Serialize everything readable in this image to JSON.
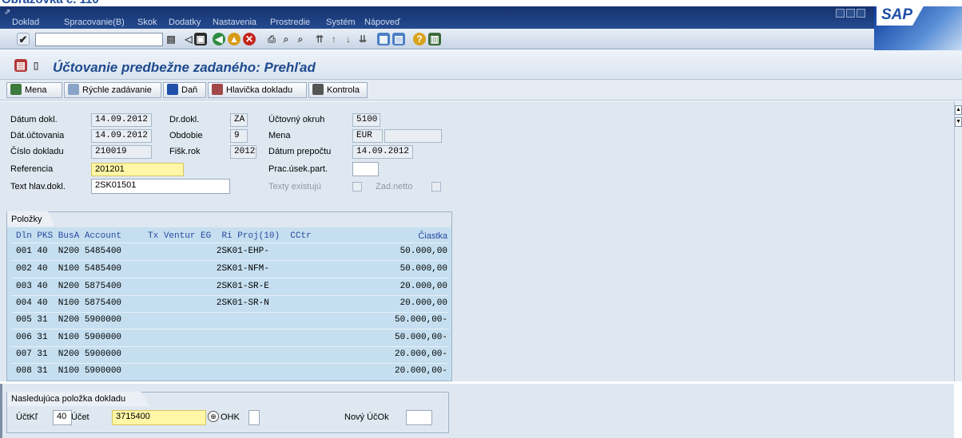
{
  "doc_caption": "Obrazovka č. 110",
  "menu": [
    "Doklad",
    "Spracovanie(B)",
    "Skok",
    "Dodatky",
    "Nastavenia",
    "Prostredie",
    "Systém",
    "Nápoveď"
  ],
  "sap_logo": "SAP",
  "page_title": "Účtovanie predbežne zadaného: Prehľad",
  "toolbar2": {
    "mena": "Mena",
    "rychle": "Rýchle zadávanie",
    "dan": "Daň",
    "hlavicka": "Hlavička dokladu",
    "kontrola": "Kontrola"
  },
  "header": {
    "datum_dokl_label": "Dátum dokl.",
    "datum_dokl": "14.09.2012",
    "dr_dokl_label": "Dr.dokl.",
    "dr_dokl": "ZA",
    "uctovny_okruh_label": "Účtovný okruh",
    "uctovny_okruh": "5100",
    "dat_uctovania_label": "Dát.účtovania",
    "dat_uctovania": "14.09.2012",
    "obdobie_label": "Obdobie",
    "obdobie": "9",
    "mena_label": "Mena",
    "mena": "EUR",
    "cislo_dokladu_label": "Číslo dokladu",
    "cislo_dokladu": "210019",
    "fisk_rok_label": "Fišk.rok",
    "fisk_rok": "2012",
    "datum_prepoctu_label": "Dátum prepočtu",
    "datum_prepoctu": "14.09.2012",
    "referencia_label": "Referencia",
    "referencia": "201201",
    "prac_usek_label": "Prac.úsek.part.",
    "text_hlav_label": "Text hlav.dokl.",
    "text_hlav": "2SK01501",
    "texty_existuju_label": "Texty existujú",
    "zad_netto_label": "Zad.netto"
  },
  "items": {
    "title": "Položky",
    "header_cols": "Dln PKS BusA Account     Tx Ventur EG  Ri Proj(10)  CCtr",
    "header_amount": "Čiastka",
    "rows": [
      {
        "text": "001 40  N200 5485400                  2SK01-EHP-",
        "amount": "50.000,00"
      },
      {
        "text": "002 40  N100 5485400                  2SK01-NFM-",
        "amount": "50.000,00"
      },
      {
        "text": "003 40  N200 5875400                  2SK01-SR-E",
        "amount": "20.000,00"
      },
      {
        "text": "004 40  N100 5875400                  2SK01-SR-N",
        "amount": "20.000,00"
      },
      {
        "text": "005 31  N200 5900000",
        "amount": "50.000,00-"
      },
      {
        "text": "006 31  N100 5900000",
        "amount": "50.000,00-"
      },
      {
        "text": "007 31  N200 5900000",
        "amount": "20.000,00-"
      },
      {
        "text": "008 31  N100 5900000",
        "amount": "20.000,00-"
      }
    ]
  },
  "next_item": {
    "title": "Nasledujúca položka dokladu",
    "uckl_label": "ÚčtKľ",
    "uckl": "40",
    "ucet_label": "Účet",
    "ucet": "3715400",
    "ohk_label": "OHK",
    "novy_ucok_label": "Nový ÚčOk"
  }
}
